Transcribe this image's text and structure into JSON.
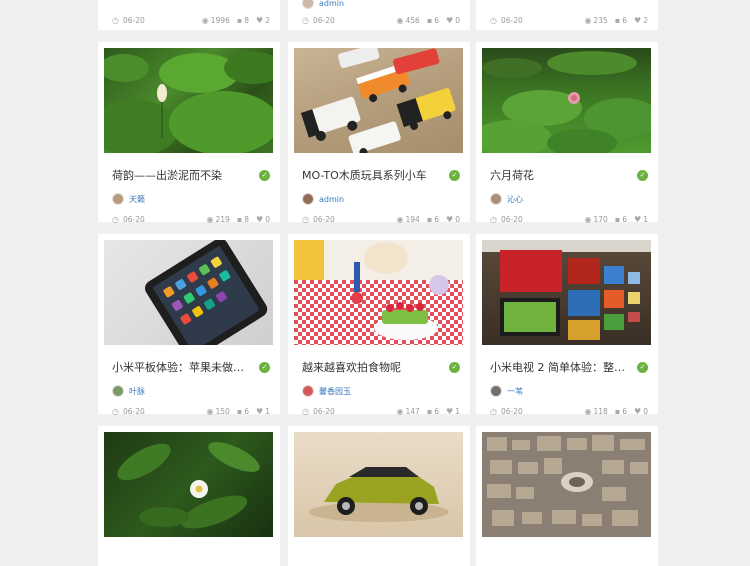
{
  "top_row": [
    {
      "author": "",
      "date": "06-20",
      "views": "1996",
      "comments": "8",
      "likes": "2"
    },
    {
      "author": "admin",
      "date": "06-20",
      "views": "456",
      "comments": "6",
      "likes": "0"
    },
    {
      "author": "",
      "date": "06-20",
      "views": "235",
      "comments": "6",
      "likes": "2"
    }
  ],
  "cards": [
    {
      "title": "荷韵——出淤泥而不染",
      "author": "天籁",
      "date": "06-20",
      "views": "219",
      "comments": "8",
      "likes": "0"
    },
    {
      "title": "MO-TO木质玩具系列小车",
      "author": "admin",
      "date": "06-20",
      "views": "194",
      "comments": "6",
      "likes": "0"
    },
    {
      "title": "六月荷花",
      "author": "沁心",
      "date": "06-20",
      "views": "170",
      "comments": "6",
      "likes": "1"
    },
    {
      "title": "小米平板体验：苹果未做的...",
      "author": "叶脉",
      "date": "06-20",
      "views": "150",
      "comments": "6",
      "likes": "1"
    },
    {
      "title": "越来越喜欢拍食物呢",
      "author": "馨香园玉",
      "date": "06-20",
      "views": "147",
      "comments": "6",
      "likes": "1"
    },
    {
      "title": "小米电视 2 简单体验：整体...",
      "author": "一苇",
      "date": "06-20",
      "views": "118",
      "comments": "6",
      "likes": "0"
    }
  ],
  "icons": {
    "clock": "clock-icon",
    "eye": "eye-icon",
    "comment": "comment-icon",
    "heart": "heart-icon",
    "verified": "verified-icon"
  }
}
